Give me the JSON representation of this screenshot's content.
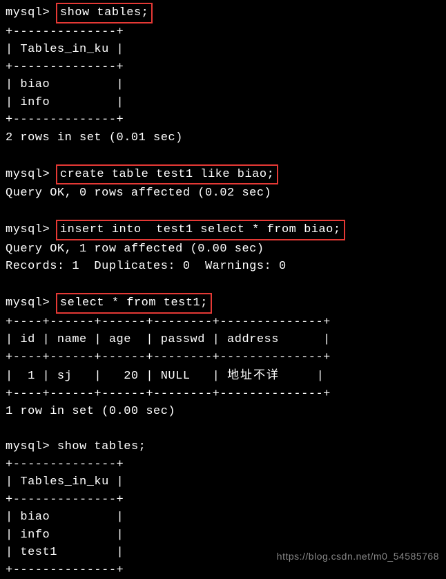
{
  "prompt": "mysql> ",
  "commands": {
    "cmd1": "show tables;",
    "cmd2": "create table test1 like biao;",
    "cmd3": "insert into  test1 select * from biao;",
    "cmd4": "select * from test1;",
    "cmd5": "show tables;"
  },
  "output1": {
    "border": "+--------------+",
    "header": "| Tables_in_ku |",
    "rows": [
      "| biao         |",
      "| info         |"
    ],
    "footer": "2 rows in set (0.01 sec)"
  },
  "output2": {
    "line1": "Query OK, 0 rows affected (0.02 sec)"
  },
  "output3": {
    "line1": "Query OK, 1 row affected (0.00 sec)",
    "line2": "Records: 1  Duplicates: 0  Warnings: 0"
  },
  "output4": {
    "border": "+----+------+------+--------+--------------+",
    "header": "| id | name | age  | passwd | address      |",
    "row_prefix": "|  1 | sj   |   20 | NULL   | ",
    "row_cjk": "地址不详",
    "row_suffix": "     |",
    "footer": "1 row in set (0.00 sec)"
  },
  "output5": {
    "border": "+--------------+",
    "header": "| Tables_in_ku |",
    "rows": [
      "| biao         |",
      "| info         |",
      "| test1        |"
    ]
  },
  "watermark": "https://blog.csdn.net/m0_54585768"
}
